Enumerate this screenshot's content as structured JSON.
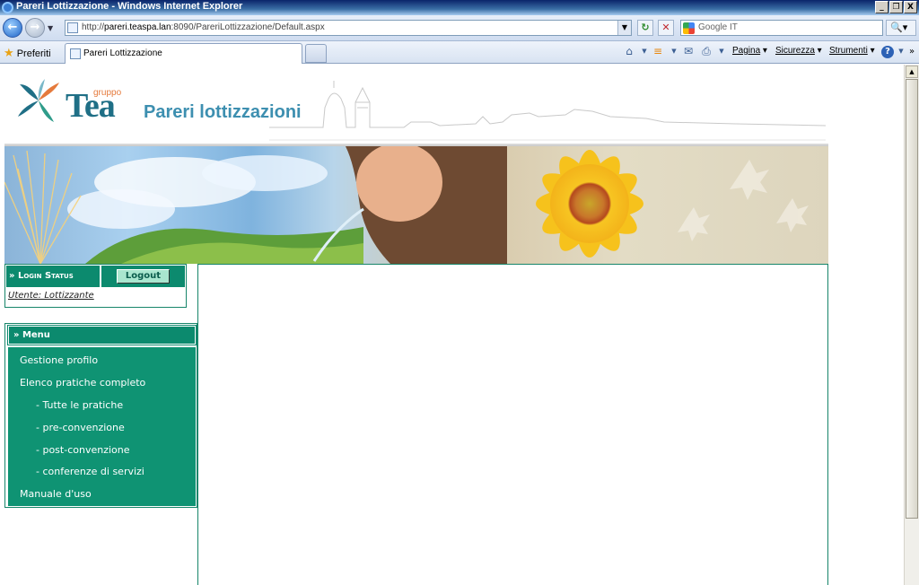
{
  "window": {
    "title": "Pareri Lottizzazione - Windows Internet Explorer",
    "controls": [
      "_",
      "❐",
      "X"
    ]
  },
  "address": {
    "url_prefix": "http://",
    "url_host": "pareri.teaspa.lan",
    "url_rest": ":8090/PareriLottizzazione/Default.aspx",
    "search_placeholder": "Google IT"
  },
  "favbar": {
    "favorites_label": "Preferiti",
    "tab_title": "Pareri Lottizzazione",
    "commands": {
      "page": "Pagina",
      "security": "Sicurezza",
      "tools": "Strumenti"
    }
  },
  "header": {
    "logo_small": "gruppo",
    "logo_big": "Tea",
    "app_title": "Pareri lottizzazioni"
  },
  "login": {
    "status_label": "» Login Status",
    "logout_label": "Logout",
    "user_text": "Utente: Lottizzante"
  },
  "menu": {
    "title": "» Menu",
    "items": [
      "Gestione profilo",
      "Elenco pratiche completo",
      "- Tutte le pratiche",
      "- pre-convenzione",
      "- post-convenzione",
      "- conferenze di servizi",
      "Manuale d'uso"
    ]
  },
  "colors": {
    "brand_green": "#0c8a6e",
    "title_blue": "#3d8fb0",
    "logo_blue": "#1f6f86",
    "logo_orange": "#e57a3c"
  }
}
